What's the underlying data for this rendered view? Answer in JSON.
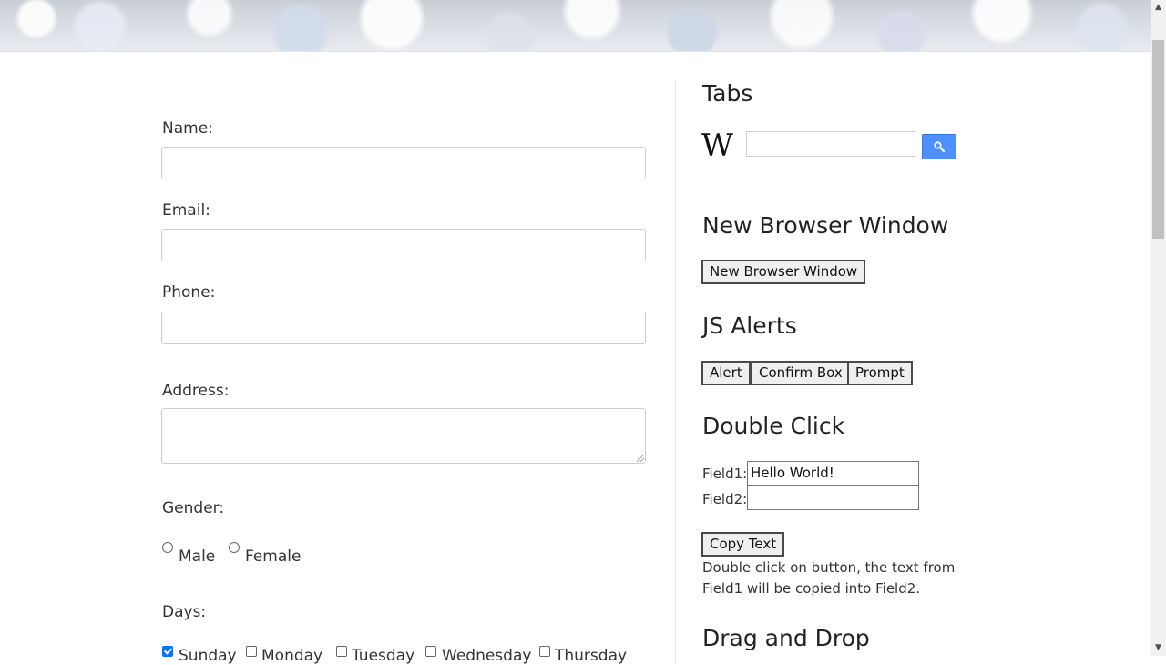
{
  "form": {
    "name_label": "Name:",
    "email_label": "Email:",
    "phone_label": "Phone:",
    "address_label": "Address:",
    "name_value": "",
    "email_value": "",
    "phone_value": "",
    "address_value": "",
    "gender_label": "Gender:",
    "gender_options": [
      "Male",
      "Female"
    ],
    "days_label": "Days:",
    "days": [
      {
        "label": "Sunday",
        "checked": true
      },
      {
        "label": "Monday",
        "checked": false
      },
      {
        "label": "Tuesday",
        "checked": false
      },
      {
        "label": "Wednesday",
        "checked": false
      },
      {
        "label": "Thursday",
        "checked": false
      }
    ]
  },
  "tabs": {
    "title": "Tabs",
    "logo_text": "W",
    "search_value": ""
  },
  "new_window": {
    "title": "New Browser Window",
    "button_label": "New Browser Window"
  },
  "alerts": {
    "title": "JS Alerts",
    "buttons": [
      "Alert",
      "Confirm Box",
      "Prompt"
    ]
  },
  "double_click": {
    "title": "Double Click",
    "field1_label": "Field1:",
    "field1_value": "Hello World!",
    "field2_label": "Field2:",
    "field2_value": "",
    "button_label": "Copy Text",
    "help_text": "Double click on button, the text from Field1 will be copied into Field2."
  },
  "drag_drop": {
    "title": "Drag and Drop"
  },
  "colors": {
    "search_button": "#4d90fe",
    "checkbox_checked": "#0075ff"
  }
}
